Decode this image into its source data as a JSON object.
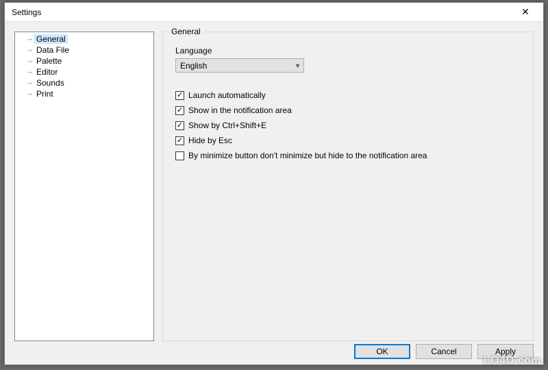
{
  "window": {
    "title": "Settings",
    "close_glyph": "✕"
  },
  "tree": {
    "items": [
      {
        "label": "General",
        "selected": true
      },
      {
        "label": "Data File",
        "selected": false
      },
      {
        "label": "Palette",
        "selected": false
      },
      {
        "label": "Editor",
        "selected": false
      },
      {
        "label": "Sounds",
        "selected": false
      },
      {
        "label": "Print",
        "selected": false
      }
    ]
  },
  "panel": {
    "title": "General",
    "language_label": "Language",
    "language_value": "English",
    "checkboxes": [
      {
        "label": "Launch automatically",
        "checked": true
      },
      {
        "label": "Show in the notification area",
        "checked": true
      },
      {
        "label": "Show by Ctrl+Shift+E",
        "checked": true
      },
      {
        "label": "Hide by Esc",
        "checked": true
      },
      {
        "label": "By minimize button don't minimize but hide to the notification area",
        "checked": false
      }
    ]
  },
  "buttons": {
    "ok": "OK",
    "cancel": "Cancel",
    "apply": "Apply"
  },
  "watermark": "LO4D.com"
}
